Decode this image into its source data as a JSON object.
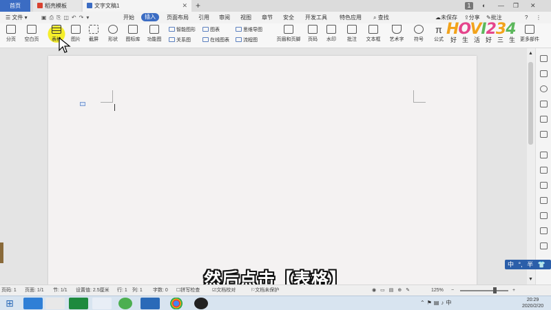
{
  "tabs": {
    "home": "首页",
    "t1": "稻壳模板",
    "t2": "文字文稿1",
    "new": "+",
    "badge": "1"
  },
  "menu": {
    "file": "文件",
    "items": [
      "开始",
      "插入",
      "页面布局",
      "引用",
      "审阅",
      "视图",
      "章节",
      "安全",
      "开发工具",
      "特色应用"
    ],
    "active_index": 1,
    "search": "查找",
    "unsaved": "未保存",
    "share": "分享",
    "annotate": "批注"
  },
  "ribbon": {
    "big": [
      "分页",
      "空白页",
      "表格",
      "图片",
      "截屏",
      "形状",
      "图标库",
      "功能图"
    ],
    "small_col1": [
      "智能图形",
      "关系图"
    ],
    "small_col2": [
      "图表",
      "在线图表"
    ],
    "small_col3": [
      "思维导图",
      "流程图"
    ],
    "big2": [
      "页眉和页脚",
      "页码",
      "水印",
      "批注",
      "文本框",
      "艺术字",
      "符号",
      "公式"
    ],
    "more": "更多部件"
  },
  "statusbar": {
    "page": "页码: 1",
    "pages": "页面: 1/1",
    "section": "节: 1/1",
    "setting": "设置值: 2.5厘米",
    "row": "行: 1",
    "col": "列: 1",
    "words": "字数: 0",
    "spell": "拼写检查",
    "proof": "文档校对",
    "protect": "文档未保护",
    "zoom": "125%"
  },
  "subtitle": "然后点击【表格】",
  "watermark": {
    "brand": "HOVI234",
    "tagline": "好生活好三生"
  },
  "ime": {
    "label": "中",
    "mode": "半"
  },
  "clock": {
    "time": "20:29",
    "date": "2020/2/20"
  },
  "colors": {
    "accent": "#3b6cc3",
    "subtitle_fill": "#ffffff",
    "watermark_orange": "#f2a31b",
    "watermark_pink": "#e5458c",
    "watermark_green": "#5cb85c"
  }
}
